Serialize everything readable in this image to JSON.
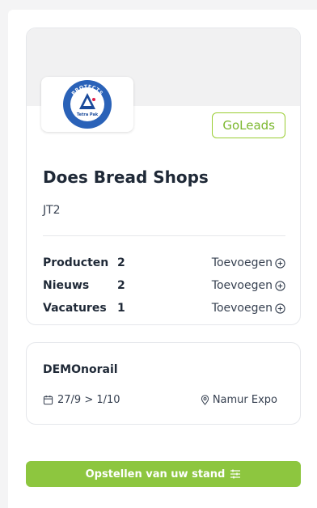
{
  "company": {
    "name": "Does Bread Shops",
    "code": "JT2",
    "badge": "GoLeads",
    "logo_text": {
      "arc_top": "PROTECTS",
      "arc_bottom": "WHAT'S GOOD",
      "center": "Tetra Pak"
    }
  },
  "stats": [
    {
      "label": "Producten",
      "count": "2",
      "action": "Toevoegen"
    },
    {
      "label": "Nieuws",
      "count": "2",
      "action": "Toevoegen"
    },
    {
      "label": "Vacatures",
      "count": "1",
      "action": "Toevoegen"
    }
  ],
  "event": {
    "name": "DEMOnorail",
    "dates": "27/9 > 1/10",
    "location": "Namur Expo"
  },
  "cta": {
    "label": "Opstellen van uw stand"
  },
  "colors": {
    "accent": "#8dc63f",
    "badge": "#7cb82f",
    "logo_blue": "#1b4b9b"
  },
  "icons": {
    "add": "plus-circle-icon",
    "calendar": "calendar-icon",
    "location": "map-pin-icon",
    "settings": "sliders-icon"
  }
}
